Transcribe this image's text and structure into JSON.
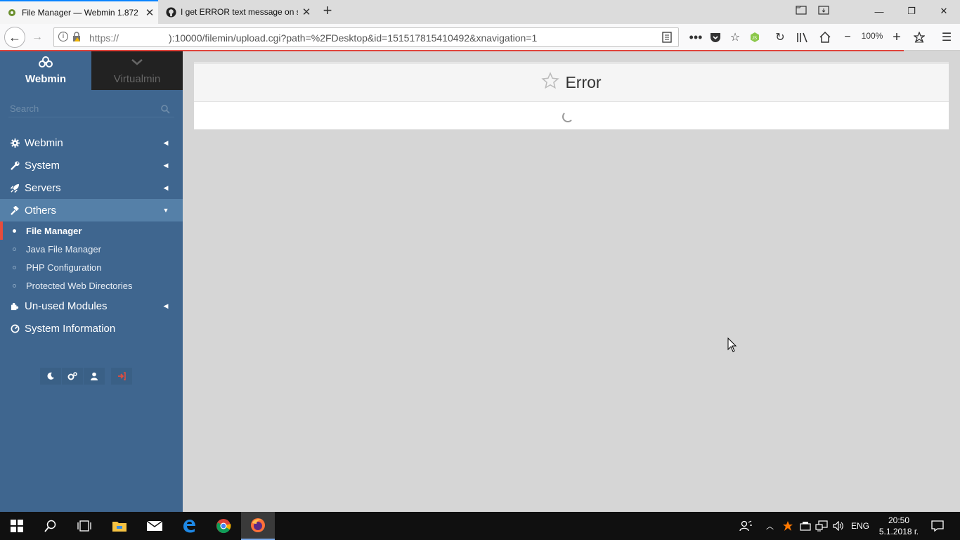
{
  "browser": {
    "tabs": [
      {
        "title": "File Manager — Webmin 1.872",
        "active": true
      },
      {
        "title": "I get ERROR text message on sc",
        "active": false
      }
    ],
    "url_prefix": "https://",
    "url_rest": "):10000/filemin/upload.cgi?path=%2FDesktop&id=151517815410492&xnavigation=1",
    "zoom": "100%",
    "accent_color": "#0a84ff",
    "loading_bar_color": "#e0443b"
  },
  "sidebar": {
    "switch": {
      "webmin": "Webmin",
      "virtualmin": "Virtualmin"
    },
    "search_placeholder": "Search",
    "menu": [
      {
        "label": "Webmin",
        "icon": "gear-icon"
      },
      {
        "label": "System",
        "icon": "wrench-icon"
      },
      {
        "label": "Servers",
        "icon": "rocket-icon"
      },
      {
        "label": "Others",
        "icon": "gavel-icon",
        "open": true
      }
    ],
    "submenu": [
      {
        "label": "File Manager",
        "active": true
      },
      {
        "label": "Java File Manager"
      },
      {
        "label": "PHP Configuration"
      },
      {
        "label": "Protected Web Directories"
      }
    ],
    "menu_after": [
      {
        "label": "Un-used Modules",
        "icon": "puzzle-icon"
      },
      {
        "label": "System Information",
        "icon": "dashboard-icon"
      }
    ],
    "bottom_buttons": [
      "moon-icon",
      "cogs-icon",
      "user-icon",
      "logout-icon"
    ],
    "bg_color": "#3f668f",
    "active_marker_color": "#e74c3c"
  },
  "main": {
    "title": "Error"
  },
  "taskbar": {
    "language": "ENG",
    "time": "20:50",
    "date": "5.1.2018 г."
  }
}
